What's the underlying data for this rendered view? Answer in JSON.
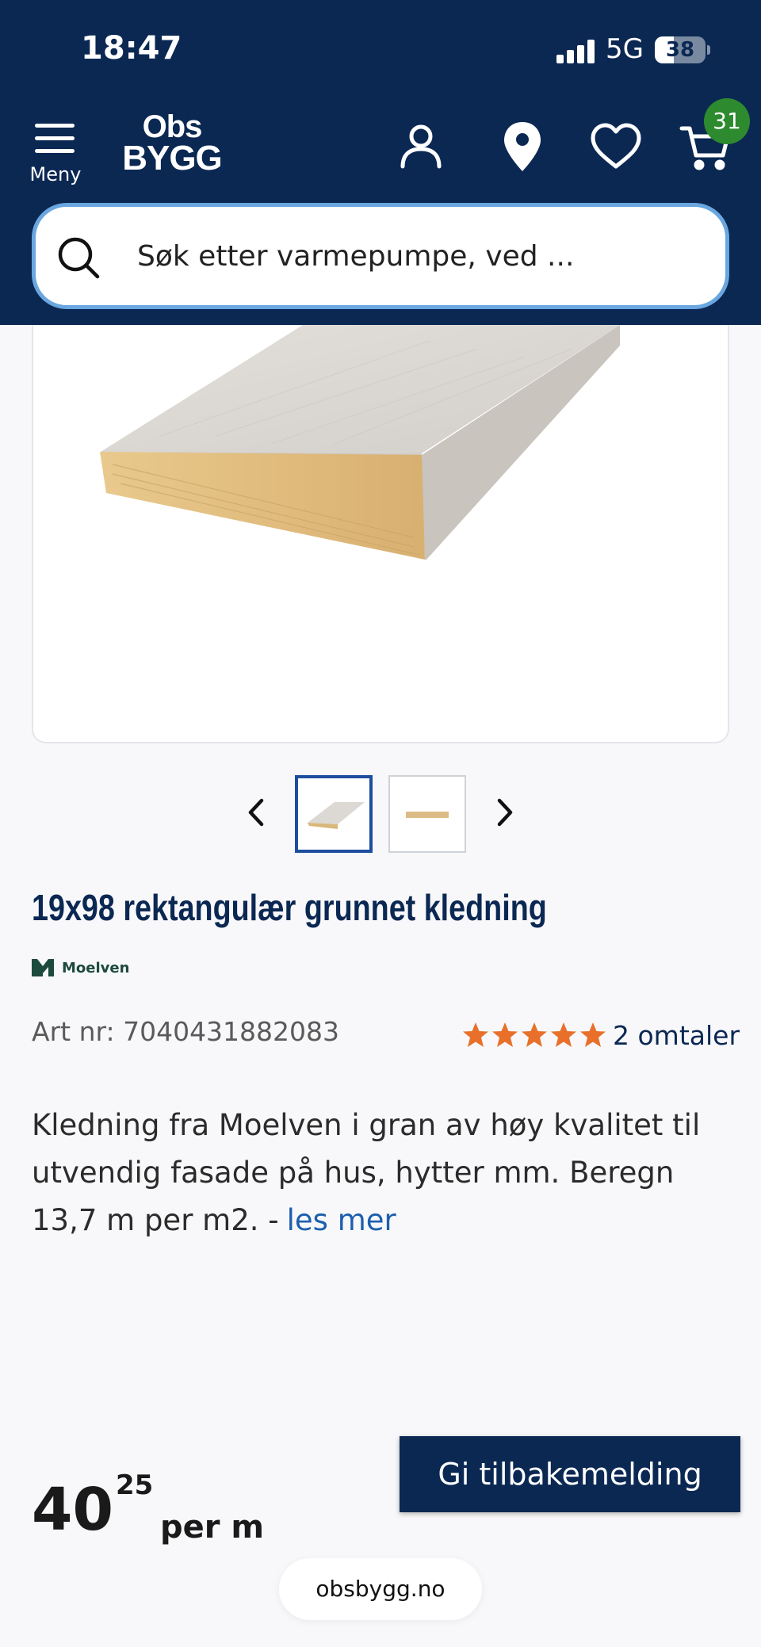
{
  "status_bar": {
    "time": "18:47",
    "network": "5G",
    "battery": "38",
    "battery_level": 0.38
  },
  "header": {
    "menu_label": "Meny",
    "logo_line1": "Obs",
    "logo_line2": "BYGG",
    "cart_count": "31",
    "icons": [
      "account-icon",
      "location-pin-icon",
      "heart-icon",
      "cart-icon"
    ]
  },
  "search": {
    "placeholder": "Søk etter varmepumpe, ved ..."
  },
  "product": {
    "title": "19x98 rektangulær grunnet kledning",
    "brand": "Moelven",
    "art_nr": "Art nr: 7040431882083",
    "rating": 5,
    "reviews": "2 omtaler",
    "description": "Kledning fra Moelven i gran av høy kvalitet til utvendig fasade på hus, hytter mm. Beregn 13,7 m per m2. -",
    "read_more": "les mer",
    "price_main": "40",
    "price_cents": "25",
    "price_unit": "per m"
  },
  "feedback_button": "Gi tilbakemelding",
  "browser": {
    "url": "obsbygg.no"
  },
  "colors": {
    "header": "#0b2853",
    "accent_link": "#1d5fae",
    "star": "#e8702a",
    "badge": "#2e8a2e"
  }
}
